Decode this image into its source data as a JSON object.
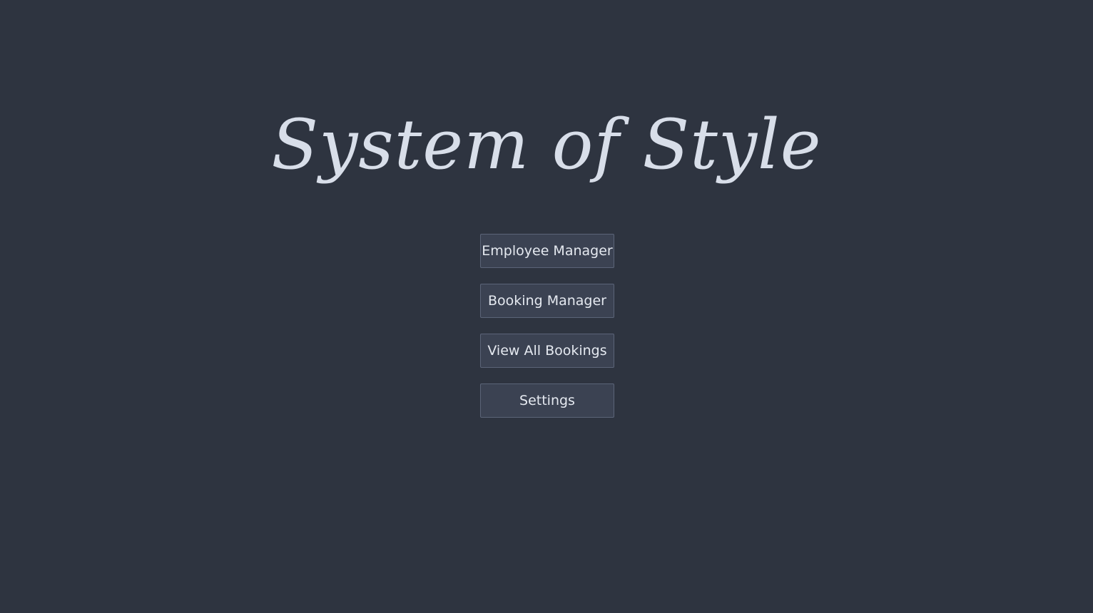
{
  "app": {
    "title": "System of Style"
  },
  "menu": {
    "buttons": [
      {
        "label": "Employee Manager"
      },
      {
        "label": "Booking Manager"
      },
      {
        "label": "View All Bookings"
      },
      {
        "label": "Settings"
      }
    ]
  },
  "colors": {
    "background": "#2e3440",
    "button_background": "#3b4252",
    "button_border": "#5b6478",
    "text": "#d8dee9"
  }
}
